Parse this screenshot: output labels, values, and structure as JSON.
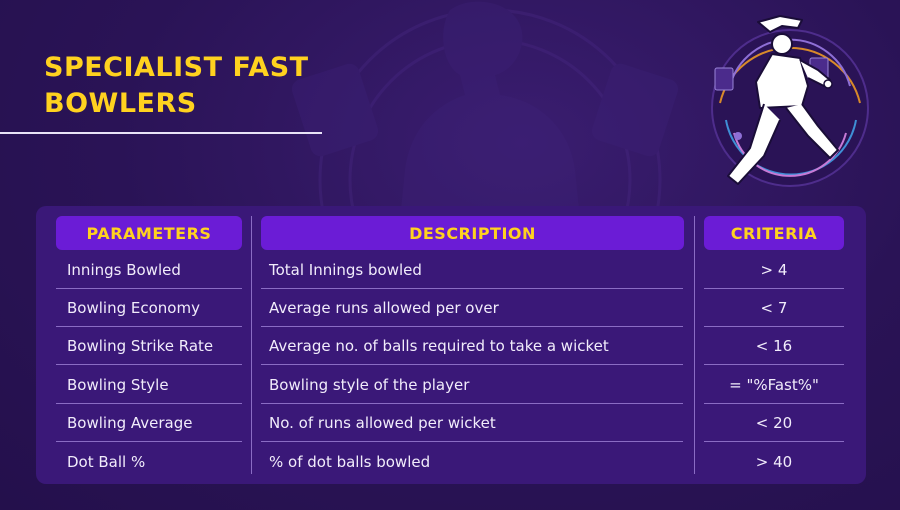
{
  "page": {
    "title": "SPECIALIST FAST BOWLERS",
    "colors": {
      "background": "#2a1356",
      "panel": "#3a1878",
      "header_fill": "#6b1cd6",
      "accent_yellow": "#ffd21f",
      "text": "#f1ecfb"
    }
  },
  "table": {
    "headers": [
      "PARAMETERS",
      "DESCRIPTION",
      "CRITERIA"
    ],
    "rows": [
      {
        "parameter": "Innings Bowled",
        "description": "Total Innings bowled",
        "criteria": "> 4"
      },
      {
        "parameter": "Bowling Economy",
        "description": "Average runs allowed per over",
        "criteria": "< 7"
      },
      {
        "parameter": "Bowling Strike Rate",
        "description": "Average no. of balls required to take a wicket",
        "criteria": "< 16"
      },
      {
        "parameter": "Bowling Style",
        "description": "Bowling style of the player",
        "criteria": "= \"%Fast%\""
      },
      {
        "parameter": "Bowling Average",
        "description": "No. of runs allowed per wicket",
        "criteria": "< 20"
      },
      {
        "parameter": "Dot Ball %",
        "description": "% of dot balls bowled",
        "criteria": "> 40"
      }
    ]
  },
  "illustration": {
    "icon": "fast-bowler-illustration-icon"
  }
}
